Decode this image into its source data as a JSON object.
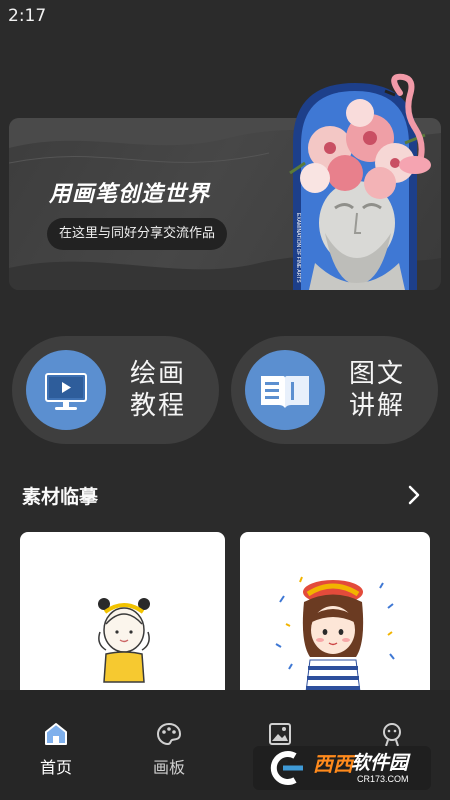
{
  "status": {
    "time": "2:17"
  },
  "banner": {
    "title": "用画笔创造世界",
    "subtitle": "在这里与同好分享交流作品",
    "art_caption": "EXAMINATION OF FINE ARTS"
  },
  "features": [
    {
      "label": "绘画教程",
      "icon": "monitor-play-icon"
    },
    {
      "label": "图文讲解",
      "icon": "open-book-icon"
    }
  ],
  "section": {
    "title": "素材临摹",
    "more_icon": "chevron-right-icon"
  },
  "cards": [
    {
      "name": "sketch-girl-bun",
      "alt": ""
    },
    {
      "name": "sketch-girl-beret",
      "alt": ""
    }
  ],
  "nav": [
    {
      "label": "首页",
      "icon": "home-icon",
      "active": true
    },
    {
      "label": "画板",
      "icon": "palette-icon",
      "active": false
    },
    {
      "label": "",
      "icon": "gallery-icon",
      "active": false
    },
    {
      "label": "",
      "icon": "profile-icon",
      "active": false
    }
  ],
  "watermark": {
    "brand_a": "西西",
    "brand_b": "软件园",
    "domain": "CR173.COM"
  },
  "colors": {
    "background": "#2b2b2b",
    "accent": "#5b8fd0",
    "card": "#ffffff"
  }
}
